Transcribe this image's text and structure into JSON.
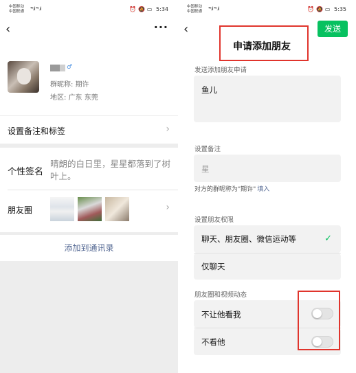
{
  "left": {
    "status": {
      "carrier1": "中国移动 ",
      "carrier2": "中国联通 ",
      "signal": "⁴⁶.ıl ⁴ᴳ.ıl",
      "time": "5:34"
    },
    "profile": {
      "nickname_label": "群昵称:",
      "nickname_value": "期许",
      "region_label": "地区:",
      "region_value": "广东  东莞"
    },
    "rows": {
      "remark": "设置备注和标签",
      "signature_label": "个性签名",
      "signature_text": "晴朗的白日里，星星都落到了树叶上。",
      "moments_label": "朋友圈"
    },
    "add_contact": "添加到通讯录"
  },
  "right": {
    "status": {
      "carrier1": "中国移动 ",
      "carrier2": "中国联通 ",
      "signal": "⁴⁶.ıl ⁴ᴳ.ıl",
      "time": "5:35"
    },
    "send": "发送",
    "title": "申请添加朋友",
    "request_label": "发送添加朋友申请",
    "request_value": "鱼儿",
    "remark_label": "设置备注",
    "remark_placeholder": "星",
    "hint": "对方的群昵称为\"期许\"",
    "hint_fill": "填入",
    "perm_label": "设置朋友权限",
    "perm_option1": "聊天、朋友圈、微信运动等",
    "perm_option2": "仅聊天",
    "moments_label": "朋友圈和视频动态",
    "toggle1": "不让他看我",
    "toggle2": "不看他",
    "toggle1_on": false,
    "toggle2_on": false,
    "accent": "#07c160",
    "link": "#576b95",
    "highlight": "#e0342c"
  }
}
